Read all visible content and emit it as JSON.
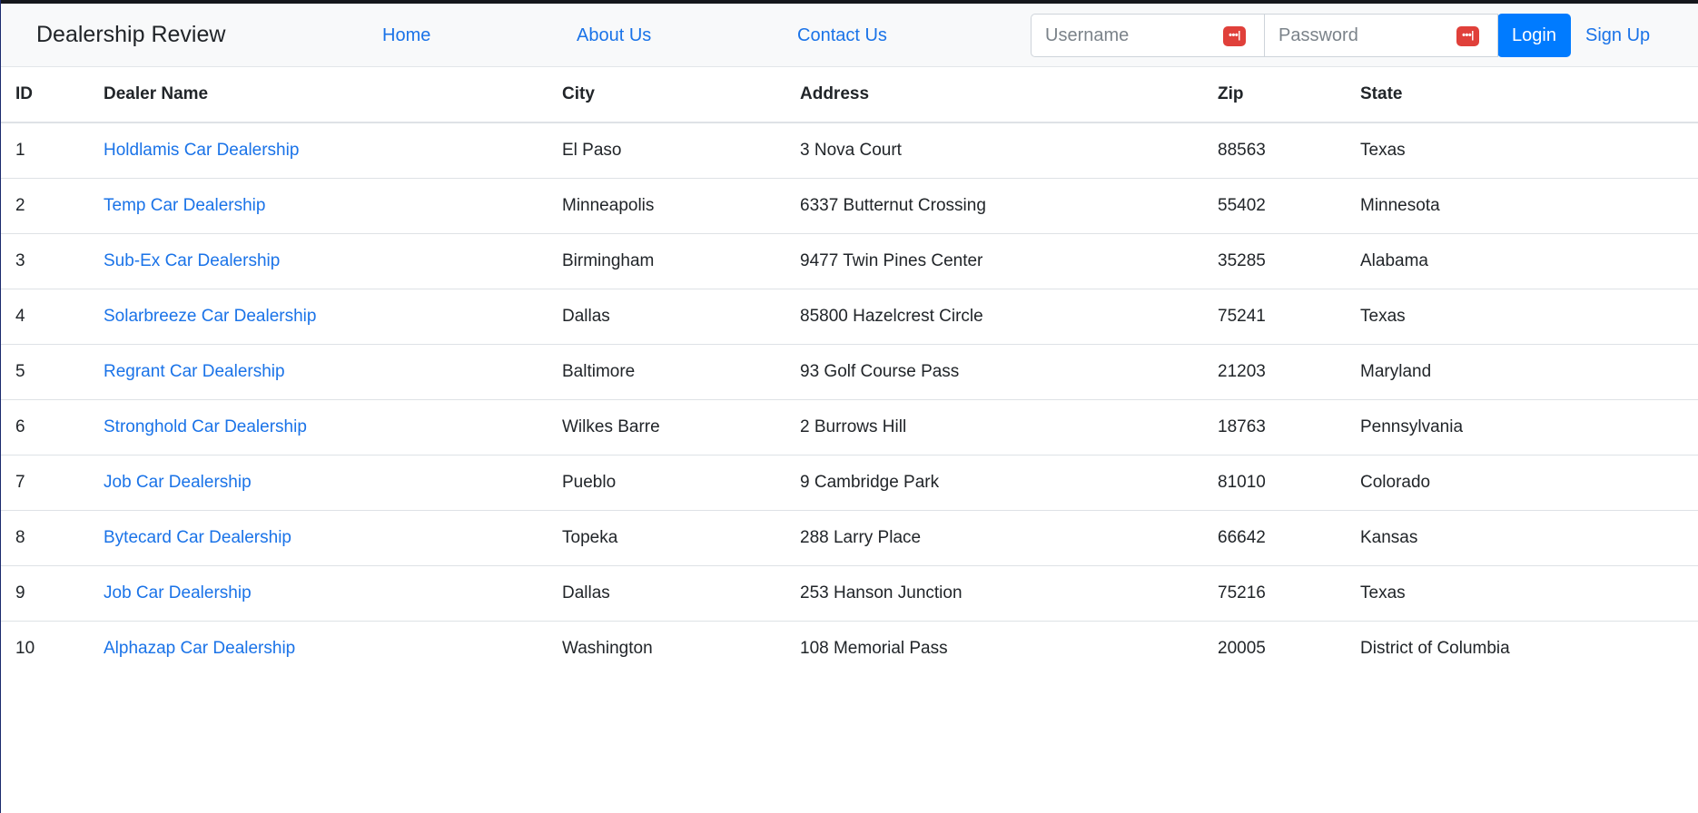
{
  "navbar": {
    "brand": "Dealership Review",
    "links": [
      "Home",
      "About Us",
      "Contact Us"
    ],
    "username_placeholder": "Username",
    "password_placeholder": "Password",
    "password_manager_icon": "password-manager-icon",
    "login_label": "Login",
    "signup_label": "Sign Up"
  },
  "table": {
    "headers": [
      "ID",
      "Dealer Name",
      "City",
      "Address",
      "Zip",
      "State"
    ],
    "rows": [
      {
        "id": "1",
        "name": "Holdlamis Car Dealership",
        "city": "El Paso",
        "address": "3 Nova Court",
        "zip": "88563",
        "state": "Texas"
      },
      {
        "id": "2",
        "name": "Temp Car Dealership",
        "city": "Minneapolis",
        "address": "6337 Butternut Crossing",
        "zip": "55402",
        "state": "Minnesota"
      },
      {
        "id": "3",
        "name": "Sub-Ex Car Dealership",
        "city": "Birmingham",
        "address": "9477 Twin Pines Center",
        "zip": "35285",
        "state": "Alabama"
      },
      {
        "id": "4",
        "name": "Solarbreeze Car Dealership",
        "city": "Dallas",
        "address": "85800 Hazelcrest Circle",
        "zip": "75241",
        "state": "Texas"
      },
      {
        "id": "5",
        "name": "Regrant Car Dealership",
        "city": "Baltimore",
        "address": "93 Golf Course Pass",
        "zip": "21203",
        "state": "Maryland"
      },
      {
        "id": "6",
        "name": "Stronghold Car Dealership",
        "city": "Wilkes Barre",
        "address": "2 Burrows Hill",
        "zip": "18763",
        "state": "Pennsylvania"
      },
      {
        "id": "7",
        "name": "Job Car Dealership",
        "city": "Pueblo",
        "address": "9 Cambridge Park",
        "zip": "81010",
        "state": "Colorado"
      },
      {
        "id": "8",
        "name": "Bytecard Car Dealership",
        "city": "Topeka",
        "address": "288 Larry Place",
        "zip": "66642",
        "state": "Kansas"
      },
      {
        "id": "9",
        "name": "Job Car Dealership",
        "city": "Dallas",
        "address": "253 Hanson Junction",
        "zip": "75216",
        "state": "Texas"
      },
      {
        "id": "10",
        "name": "Alphazap Car Dealership",
        "city": "Washington",
        "address": "108 Memorial Pass",
        "zip": "20005",
        "state": "District of Columbia"
      }
    ]
  }
}
